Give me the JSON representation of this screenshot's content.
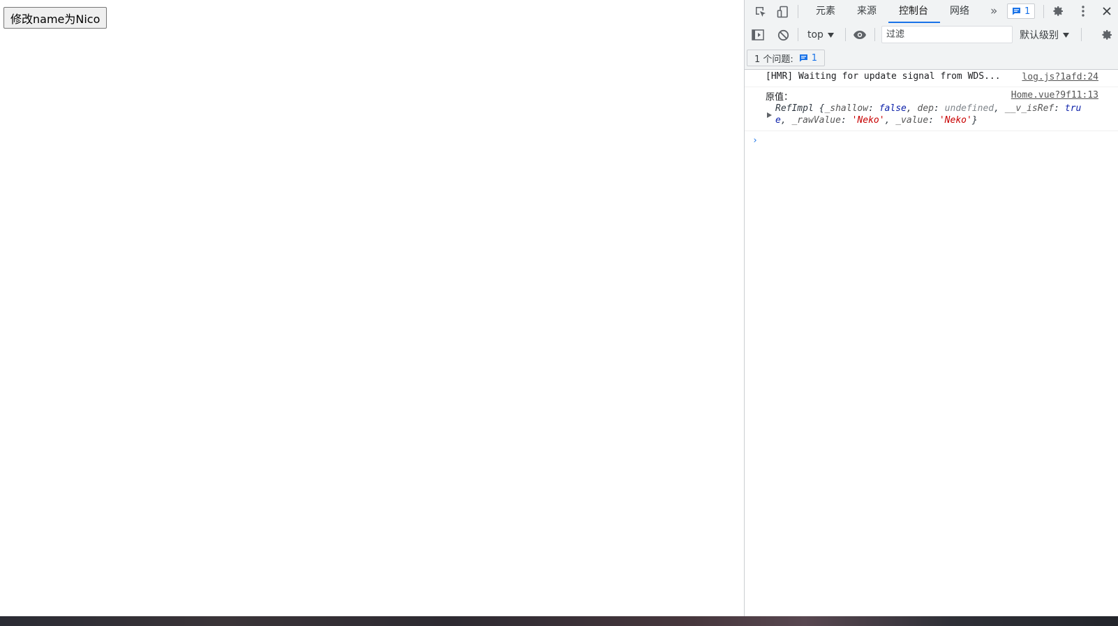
{
  "page": {
    "button_label": "修改name为Nico"
  },
  "devtools": {
    "tabs": [
      {
        "label": "元素",
        "active": false
      },
      {
        "label": "来源",
        "active": false
      },
      {
        "label": "控制台",
        "active": true
      },
      {
        "label": "网络",
        "active": false
      }
    ],
    "more_tabs_glyph": "»",
    "issues_badge_count": "1",
    "toolbar": {
      "context": "top",
      "filter_placeholder": "过滤",
      "level": "默认级别"
    },
    "issues_bar": {
      "label": "1 个问题:",
      "count": "1"
    },
    "console": {
      "messages": [
        {
          "text": "[HMR] Waiting for update signal from WDS...",
          "source": "log.js?1afd:24"
        },
        {
          "text": "原值：",
          "source": "Home.vue?9f11:13",
          "object": {
            "class": "RefImpl",
            "line1_a": "{",
            "shallow_key": "_shallow",
            "shallow_val": "false",
            "dep_key": "dep",
            "dep_val": "undefined",
            "isref_key": "__v_isRef",
            "isref_val_a": "tru",
            "isref_val_b": "e",
            "raw_key": "_rawValue",
            "raw_val": "'Neko'",
            "value_key": "_value",
            "value_val": "'Neko'"
          }
        }
      ],
      "prompt": "›"
    },
    "icons": {
      "inspect": "inspect-element-icon",
      "device": "device-toolbar-icon",
      "settings": "gear-icon",
      "menu": "kebab-menu-icon",
      "close": "close-icon",
      "sidebar": "sidebar-toggle-icon",
      "clear": "clear-console-icon",
      "eye": "live-expression-icon",
      "message": "message-icon"
    },
    "colors": {
      "accent": "#1a73e8",
      "string": "#c80000",
      "keyword": "#0d22aa"
    }
  }
}
